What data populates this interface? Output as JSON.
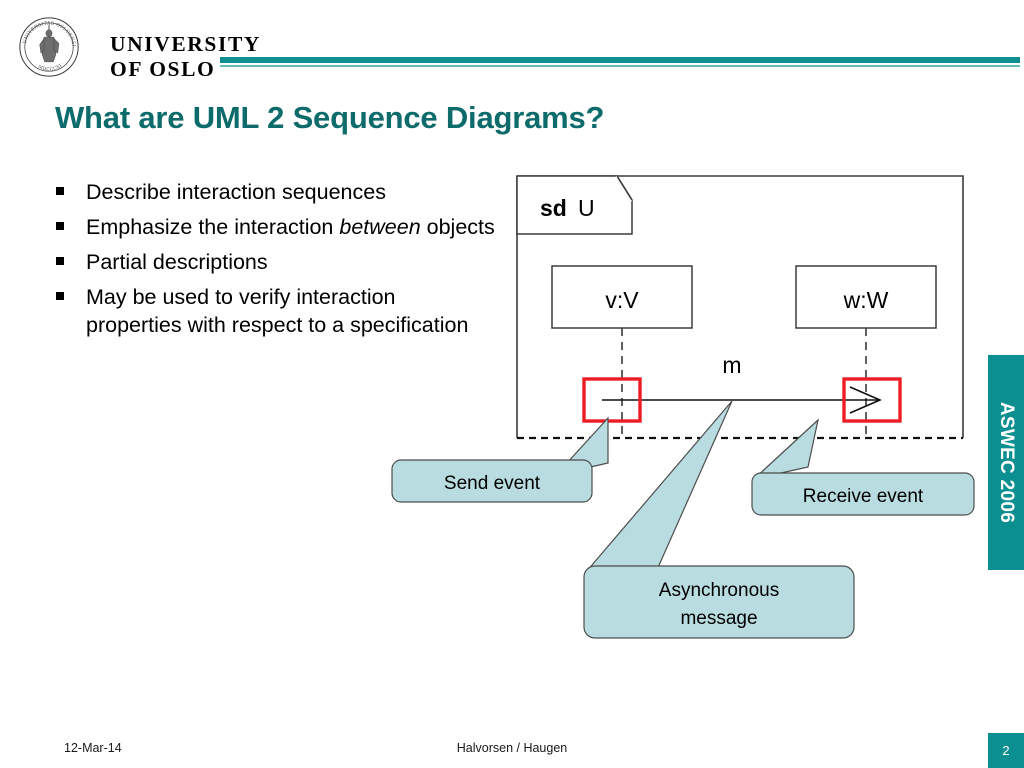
{
  "header": {
    "logo_seal_outer_text": "UNIVERSITAS OSLOENSIS",
    "logo_seal_year": "MDCCCXI",
    "university_name": "UNIVERSITY\nOF OSLO"
  },
  "title": "What are UML 2 Sequence Diagrams?",
  "bullets": [
    {
      "text_before": "Describe interaction sequences",
      "italic": "",
      "text_after": ""
    },
    {
      "text_before": "Emphasize the interaction ",
      "italic": "between",
      "text_after": " objects"
    },
    {
      "text_before": "Partial descriptions",
      "italic": "",
      "text_after": ""
    },
    {
      "text_before": "May be used to verify interaction properties with respect to a specification",
      "italic": "",
      "text_after": ""
    }
  ],
  "diagram": {
    "frame_keyword": "sd",
    "frame_name": "U",
    "lifelines": [
      {
        "label": "v:V"
      },
      {
        "label": "w:W"
      }
    ],
    "message_label": "m",
    "callouts": [
      {
        "label": "Send event"
      },
      {
        "label": "Receive event"
      },
      {
        "label": "Asynchronous message",
        "line1": "Asynchronous",
        "line2": "message"
      }
    ],
    "highlight_color": "#ee1c25",
    "callout_fill": "#b8dcdf",
    "callout_stroke": "#4d4d4d"
  },
  "sidebar": {
    "label": "ASWEC 2006",
    "color": "#0c8f90"
  },
  "footer": {
    "date": "12-Mar-14",
    "authors": "Halvorsen / Haugen",
    "page_number": "2"
  },
  "colors": {
    "title": "#0d6b6b",
    "accent": "#0f8f90"
  }
}
